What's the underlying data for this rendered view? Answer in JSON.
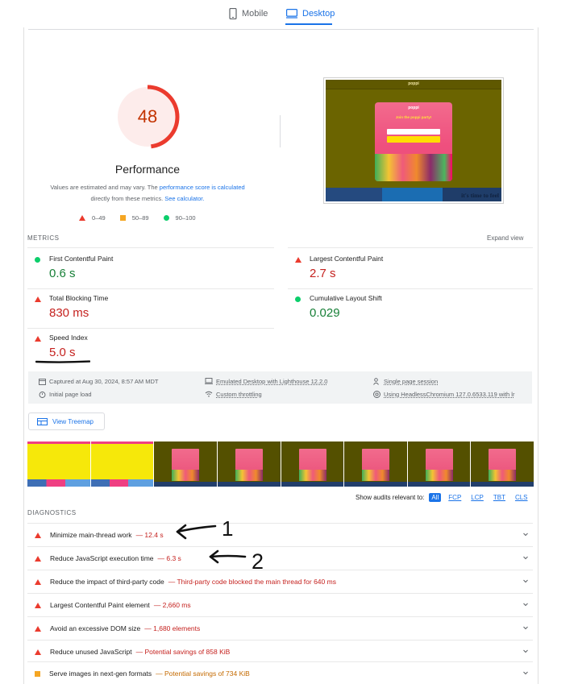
{
  "tabs": [
    {
      "label": "Mobile",
      "icon": "phone-icon",
      "active": false
    },
    {
      "label": "Desktop",
      "icon": "desktop-icon",
      "active": true
    }
  ],
  "performance": {
    "score": "48",
    "title": "Performance",
    "note_prefix": "Values are estimated and may vary. The ",
    "note_link1": "performance score is calculated",
    "note_mid": " directly from these metrics. ",
    "note_link2": "See calculator.",
    "score_color": "#eb3b2e"
  },
  "legend": [
    {
      "shape": "triangle",
      "label": "0–49",
      "color": "#eb3b2e"
    },
    {
      "shape": "square",
      "label": "50–89",
      "color": "#f5a623"
    },
    {
      "shape": "circle",
      "label": "90–100",
      "color": "#0cce6b"
    }
  ],
  "screenshot": {
    "brand": "poppi",
    "popup_brand": "poppi",
    "popup_headline": "Join the poppi party!",
    "bottom_text": "it's time to feel"
  },
  "metrics": {
    "section_label": "METRICS",
    "expand_label": "Expand view",
    "items": [
      {
        "name": "First Contentful Paint",
        "value": "0.6 s",
        "status": "good"
      },
      {
        "name": "Largest Contentful Paint",
        "value": "2.7 s",
        "status": "poor"
      },
      {
        "name": "Total Blocking Time",
        "value": "830 ms",
        "status": "poor"
      },
      {
        "name": "Cumulative Layout Shift",
        "value": "0.029",
        "status": "good"
      },
      {
        "name": "Speed Index",
        "value": "5.0 s",
        "status": "poor"
      }
    ]
  },
  "info": {
    "captured": "Captured at Aug 30, 2024, 8:57 AM MDT",
    "initial_load": "Initial page load",
    "emulated": "Emulated Desktop with Lighthouse 12.2.0",
    "throttling": "Custom throttling",
    "session": "Single page session",
    "browser": "Using HeadlessChromium 127.0.6533.119 with lr"
  },
  "treemap_label": "View Treemap",
  "filmstrip": [
    "yellow",
    "yellow",
    "dark",
    "dark",
    "dark",
    "dark",
    "dark",
    "dark"
  ],
  "filter": {
    "label": "Show audits relevant to:",
    "options": [
      "All",
      "FCP",
      "LCP",
      "TBT",
      "CLS"
    ],
    "active": "All"
  },
  "diagnostics": {
    "section_label": "DIAGNOSTICS",
    "items": [
      {
        "title": "Minimize main-thread work",
        "detail": "— 12.4 s",
        "severity": "poor"
      },
      {
        "title": "Reduce JavaScript execution time",
        "detail": "— 6.3 s",
        "severity": "poor"
      },
      {
        "title": "Reduce the impact of third-party code",
        "detail": "— Third-party code blocked the main thread for 640 ms",
        "severity": "poor"
      },
      {
        "title": "Largest Contentful Paint element",
        "detail": "— 2,660 ms",
        "severity": "poor"
      },
      {
        "title": "Avoid an excessive DOM size",
        "detail": "— 1,680 elements",
        "severity": "poor"
      },
      {
        "title": "Reduce unused JavaScript",
        "detail": "— Potential savings of 858 KiB",
        "severity": "poor"
      },
      {
        "title": "Serve images in next-gen formats",
        "detail": "— Potential savings of 734 KiB",
        "severity": "average"
      }
    ]
  },
  "annotations": [
    "1",
    "2"
  ]
}
